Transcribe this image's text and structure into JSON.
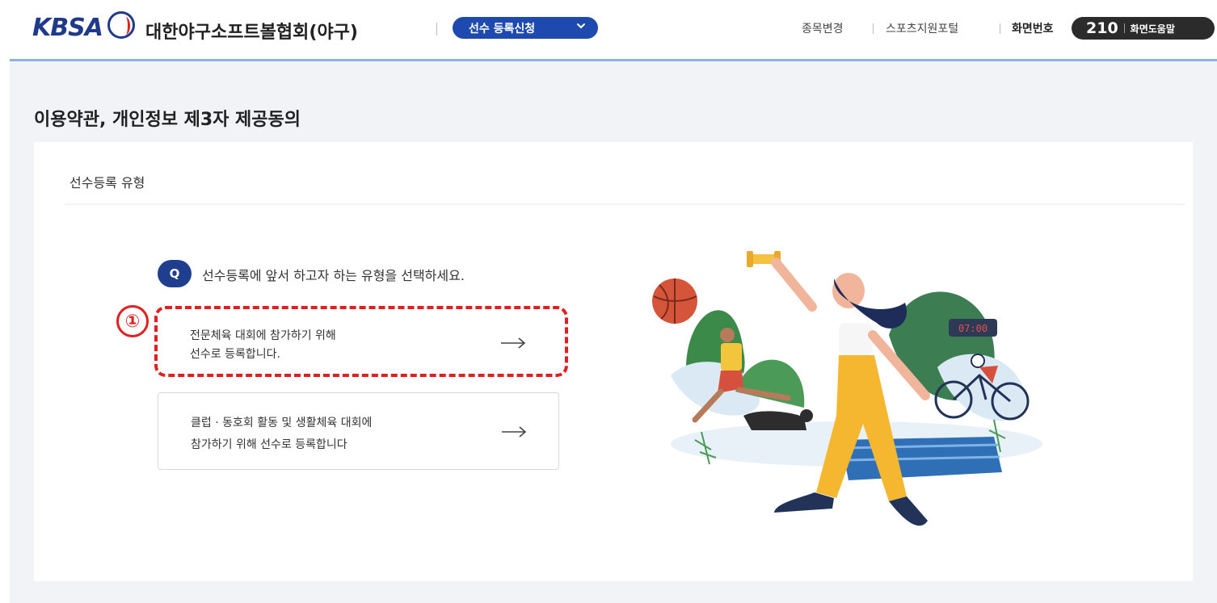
{
  "header": {
    "logo_text": "KBSA",
    "org_title": "대한야구소프트볼협회(야구)",
    "menu_label": "선수 등록신청",
    "links": [
      "종목변경",
      "스포츠지원포털"
    ],
    "screen_label": "화면번호",
    "screen_number": "210",
    "screen_help": "화면도움말"
  },
  "page": {
    "title": "이용약관, 개인정보 제3자 제공동의",
    "section_title": "선수등록 유형"
  },
  "question": {
    "badge": "Q",
    "text": "선수등록에 앞서 하고자 하는 유형을 선택하세요."
  },
  "marker": "①",
  "options": [
    {
      "line1": "전문체육 대회에 참가하기 위해",
      "line2": "선수로 등록합니다."
    },
    {
      "line1": "클럽 · 동호회 활동 및 생활체육 대회에",
      "line2": "참가하기 위해 선수로 등록합니다"
    }
  ],
  "illustration": {
    "timer_text": "07:00"
  },
  "colors": {
    "brand_blue": "#1e4ab0",
    "navy": "#1f3e8d",
    "highlight_red": "#e02020",
    "header_line": "#8fb2e6",
    "background_gray": "#f1f3f6"
  },
  "icons": [
    "chevron-down-icon",
    "arrow-right-icon",
    "baseball-icon"
  ]
}
